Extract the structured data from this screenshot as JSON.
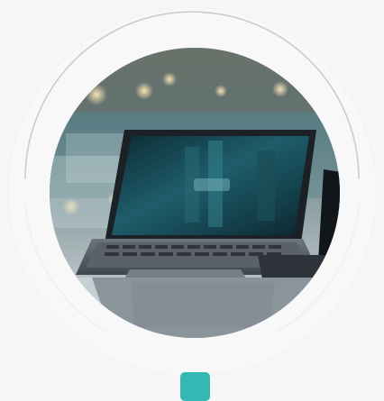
{
  "media": {
    "image_alt": "",
    "accent_color": "#35b8b3"
  },
  "indicator": {
    "color": "#35b8b3"
  }
}
